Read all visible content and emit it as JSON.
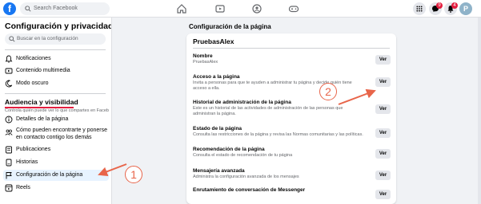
{
  "topbar": {
    "logo": "f",
    "search_placeholder": "Search Facebook",
    "notif_count": "9",
    "messages_count": "4",
    "avatar_letter": "P"
  },
  "sidebar": {
    "title": "Configuración y privacidad",
    "search_placeholder": "Buscar en la configuración",
    "items_top": [
      {
        "label": "Notificaciones",
        "icon": "bell-icon"
      },
      {
        "label": "Contenido multimedia",
        "icon": "media-icon"
      },
      {
        "label": "Modo oscuro",
        "icon": "moon-icon"
      }
    ],
    "section": {
      "title": "Audiencia y visibilidad",
      "subtitle": "Controla quién puede ver lo que compartes en Faceb..."
    },
    "items_audience": [
      {
        "label": "Detalles de la página",
        "icon": "info-icon"
      },
      {
        "label": "Cómo pueden encontrarte y ponerse en contacto contigo los demás",
        "icon": "people-icon"
      },
      {
        "label": "Publicaciones",
        "icon": "posts-icon"
      },
      {
        "label": "Historias",
        "icon": "stories-icon"
      },
      {
        "label": "Configuración de la página",
        "icon": "flag-icon"
      },
      {
        "label": "Reels",
        "icon": "reels-icon"
      }
    ]
  },
  "main": {
    "title": "Configuración de la página",
    "panel_title": "PruebasAlex",
    "button_label": "Ver",
    "rows": [
      {
        "title": "Nombre",
        "desc": "PruebasAlex"
      },
      {
        "title": "Acceso a la página",
        "desc": "Invita a personas para que te ayuden a administrar tu página y decide quién tiene acceso a ella."
      },
      {
        "title": "Historial de administración de la página",
        "desc": "Este es un historial de las actividades de administración de las personas que administran la página."
      },
      {
        "title": "Estado de la página",
        "desc": "Consulta las restricciones de la página y revisa las Normas comunitarias y las políticas."
      },
      {
        "title": "Recomendación de la página",
        "desc": "Consulta el estado de recomendación de tu página"
      },
      {
        "title": "Mensajería avanzada",
        "desc": "Administra la configuración avanzada de los mensajes"
      },
      {
        "title": "Enrutamiento de conversación de Messenger",
        "desc": ""
      }
    ]
  },
  "annotations": {
    "marker_1": "1",
    "marker_2": "2",
    "color": "#e8654a"
  }
}
